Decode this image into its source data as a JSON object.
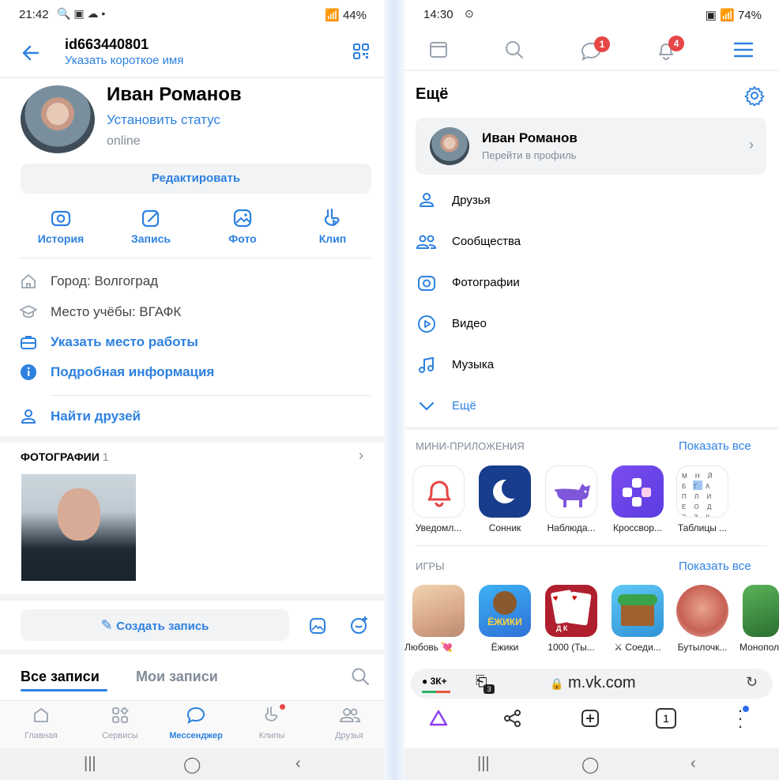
{
  "left": {
    "status": {
      "time": "21:42",
      "battery": "44%"
    },
    "header": {
      "user_id": "id663440801",
      "short_name_link": "Указать короткое имя"
    },
    "profile": {
      "name": "Иван Романов",
      "status_link": "Установить статус",
      "presence": "online"
    },
    "edit_button": "Редактировать",
    "actions": [
      "История",
      "Запись",
      "Фото",
      "Клип"
    ],
    "info": {
      "city": "Город: Волгоград",
      "school": "Место учёбы: ВГАФК",
      "work_link": "Указать место работы",
      "more_link": "Подробная информация",
      "find_friends": "Найти друзей"
    },
    "photos": {
      "title": "ФОТОГРАФИИ",
      "count": "1"
    },
    "create_post": "Создать запись",
    "feed_tabs": [
      "Все записи",
      "Мои записи"
    ],
    "bottom_tabs": [
      "Главная",
      "Сервисы",
      "Мессенджер",
      "Клипы",
      "Друзья"
    ]
  },
  "right": {
    "status": {
      "time": "14:30",
      "battery": "74%"
    },
    "badges": {
      "messages": "1",
      "notifications": "4"
    },
    "title": "Ещё",
    "profile_card": {
      "name": "Иван Романов",
      "subtitle": "Перейти в профиль"
    },
    "menu": [
      "Друзья",
      "Сообщества",
      "Фотографии",
      "Видео",
      "Музыка",
      "Ещё"
    ],
    "mini_apps": {
      "title": "МИНИ-ПРИЛОЖЕНИЯ",
      "show_all": "Показать все",
      "items": [
        "Уведомл...",
        "Сонник",
        "Наблюда...",
        "Кроссвор...",
        "Таблицы ..."
      ]
    },
    "games": {
      "title": "ИГРЫ",
      "show_all": "Показать все",
      "items": [
        "Любовь 💘",
        "Ёжики",
        "1000 (Ты...",
        "⚔ Соеди...",
        "Бутылочк...",
        "Монопол"
      ]
    },
    "browser": {
      "counter": "3К+",
      "tabs_count": "3",
      "url": "m.vk.com",
      "tab_badge": "1"
    },
    "game_tile_text": "ЁЖИКИ",
    "card_letters": "Д К",
    "grid_letters": "М Н Й Б Г А П Л И Е О Д В З К Ж"
  },
  "colors": {
    "accent": "#2d81e0",
    "badge": "#e64646",
    "secondary": "#818c99"
  }
}
